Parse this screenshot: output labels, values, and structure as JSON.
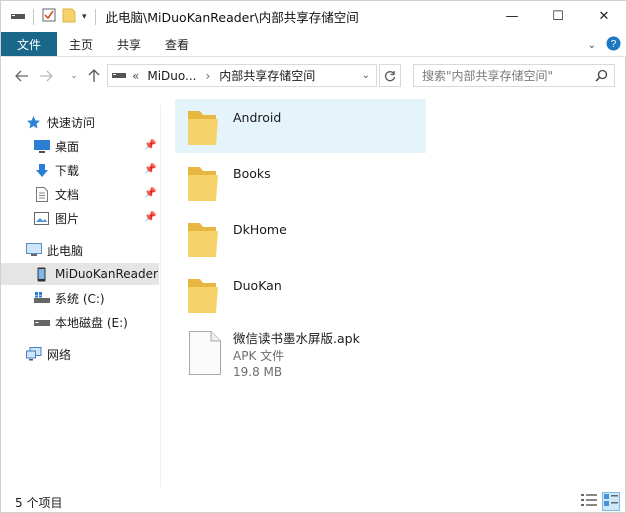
{
  "window": {
    "title": "此电脑\\MiDuoKanReader\\内部共享存储空间",
    "controls": {
      "minimize": "—",
      "maximize": "☐",
      "close": "✕"
    }
  },
  "ribbon": {
    "tabs": [
      {
        "label": "文件"
      },
      {
        "label": "主页"
      },
      {
        "label": "共享"
      },
      {
        "label": "查看"
      }
    ]
  },
  "address": {
    "overflow": "«",
    "crumbs": [
      "MiDuo...",
      "内部共享存储空间"
    ],
    "separator": "›"
  },
  "search": {
    "placeholder": "搜索\"内部共享存储空间\""
  },
  "sidebar": {
    "quick_access": "快速访问",
    "pinned": [
      {
        "label": "桌面"
      },
      {
        "label": "下载"
      },
      {
        "label": "文档"
      },
      {
        "label": "图片"
      }
    ],
    "this_pc": "此电脑",
    "device": "MiDuoKanReader",
    "drives": [
      {
        "label": "系统 (C:)"
      },
      {
        "label": "本地磁盘 (E:)"
      }
    ],
    "network": "网络"
  },
  "content": {
    "folders": [
      {
        "name": "Android",
        "selected": true
      },
      {
        "name": "Books"
      },
      {
        "name": "DkHome"
      },
      {
        "name": "DuoKan"
      }
    ],
    "file": {
      "name": "微信读书墨水屏版.apk",
      "type": "APK 文件",
      "size": "19.8 MB"
    }
  },
  "status": {
    "item_count": "5 个项目"
  },
  "colors": {
    "file_tab": "#19688a",
    "selection": "#e5f3fb",
    "folder": "#f6d36a"
  }
}
